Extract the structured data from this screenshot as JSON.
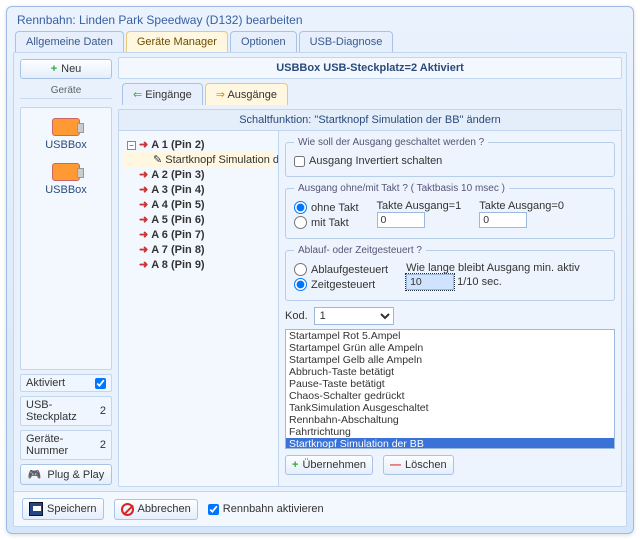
{
  "window": {
    "title": "Rennbahn: Linden Park Speedway (D132) bearbeiten"
  },
  "topTabs": {
    "general": "Allgemeine Daten",
    "devmgr": "Geräte Manager",
    "options": "Optionen",
    "usbdiag": "USB-Diagnose"
  },
  "sidebar": {
    "newBtn": "Neu",
    "devicesHeader": "Geräte",
    "devices": [
      {
        "label": "USBBox"
      },
      {
        "label": "USBBox"
      }
    ],
    "status": {
      "activated": "Aktiviert",
      "usbSlot": "USB-Steckplatz",
      "usbSlotVal": "2",
      "devNum": "Geräte-Nummer",
      "devNumVal": "2"
    },
    "pnp": "Plug & Play"
  },
  "main": {
    "banner": "USBBox  USB-Steckplatz=2  Aktiviert",
    "ioTabs": {
      "inputs": "Eingänge",
      "outputs": "Ausgänge"
    },
    "panelTitle": "Schaltfunktion:  \"Startknopf Simulation der BB\" ändern",
    "tree": {
      "root": "A 1 (Pin 2)",
      "rootChild": "Startknopf Simulation der BB",
      "items": [
        "A 2 (Pin 3)",
        "A 3 (Pin 4)",
        "A 4 (Pin 5)",
        "A 5 (Pin 6)",
        "A 6 (Pin 7)",
        "A 7 (Pin 8)",
        "A 8 (Pin 9)"
      ]
    },
    "editor": {
      "grp1": {
        "legend": "Wie soll der Ausgang geschaltet werden ?",
        "invert": "Ausgang Invertiert schalten"
      },
      "grp2": {
        "legend": "Ausgang ohne/mit Takt ?  ( Taktbasis 10 msec )",
        "noClock": "ohne Takt",
        "withClock": "mit Takt",
        "t1": "Takte Ausgang=1",
        "t0": "Takte Ausgang=0",
        "t1v": "0",
        "t0v": "0"
      },
      "grp3": {
        "legend": "Ablauf- oder Zeitgesteuert ?",
        "flow": "Ablaufgesteuert",
        "time": "Zeitgesteuert",
        "hold": "Wie lange bleibt Ausgang min. aktiv",
        "holdVal": "10",
        "holdUnit": "1/10 sec."
      },
      "kodLabel": "Kod.",
      "kodVal": "1",
      "list": [
        "Startampel Rot 5.Ampel",
        "Startampel Grün alle Ampeln",
        "Startampel Gelb alle Ampeln",
        "Abbruch-Taste betätigt",
        "Pause-Taste betätigt",
        "Chaos-Schalter gedrückt",
        "TankSimulation Ausgeschaltet",
        "Rennbahn-Abschaltung",
        "Fahrtrichtung",
        "Startknopf Simulation der BB"
      ],
      "apply": "Übernehmen",
      "delete": "Löschen"
    }
  },
  "footer": {
    "save": "Speichern",
    "cancel": "Abbrechen",
    "activate": "Rennbahn aktivieren"
  }
}
